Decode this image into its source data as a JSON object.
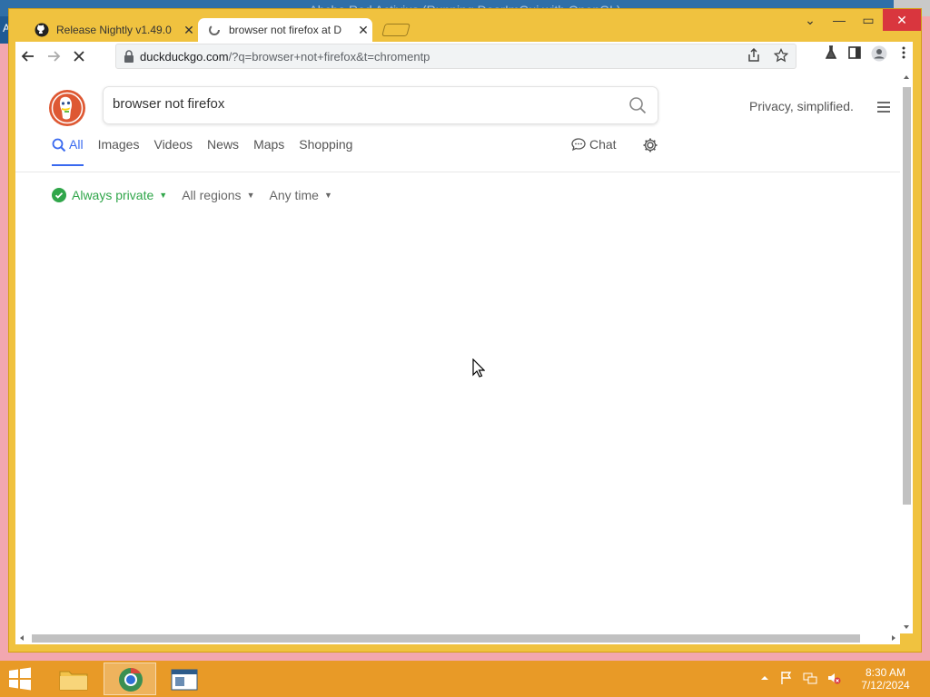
{
  "background_window": {
    "title": "Abcba Red Activius (Running DearImGui with OpenGL)",
    "side_letter": "A"
  },
  "browser": {
    "tabs": [
      {
        "label": "Release Nightly v1.49.0",
        "icon": "github-icon",
        "active": false
      },
      {
        "label": "browser not firefox at D",
        "icon": "duckduckgo-loading-icon",
        "active": true
      }
    ],
    "address": {
      "host": "duckduckgo.com",
      "rest": "/?q=browser+not+firefox&t=chromentp"
    }
  },
  "page": {
    "search_query": "browser not firefox",
    "tagline": "Privacy, simplified.",
    "tabs": [
      "All",
      "Images",
      "Videos",
      "News",
      "Maps",
      "Shopping"
    ],
    "chat_label": "Chat",
    "filters": [
      "Always private",
      "All regions",
      "Any time"
    ]
  },
  "taskbar": {
    "time": "8:30 AM",
    "date": "7/12/2024"
  },
  "colors": {
    "window_frame": "#f0c23f",
    "taskbar": "#e89a27",
    "accent_blue": "#3969ef",
    "private_green": "#30a64a",
    "ddg_orange": "#de5833"
  }
}
